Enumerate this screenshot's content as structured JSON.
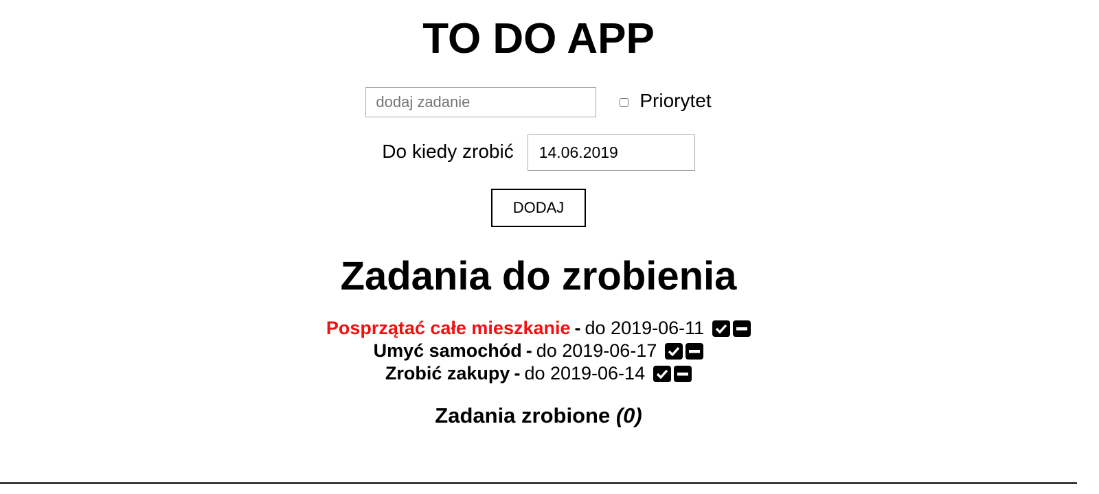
{
  "app": {
    "title": "TO DO APP"
  },
  "form": {
    "task_placeholder": "dodaj zadanie",
    "task_value": "",
    "priority_label": "Priorytet",
    "priority_checked": false,
    "date_label": "Do kiedy zrobić",
    "date_value": "14.06.2019",
    "add_button_label": "DODAJ"
  },
  "todo": {
    "heading": "Zadania do zrobienia",
    "tasks": [
      {
        "name": "Posprzątać całe mieszkanie",
        "priority": true,
        "separator": "-",
        "due": "do 2019-06-11"
      },
      {
        "name": "Umyć samochód",
        "priority": false,
        "separator": "-",
        "due": "do 2019-06-17"
      },
      {
        "name": "Zrobić zakupy",
        "priority": false,
        "separator": "-",
        "due": "do 2019-06-14"
      }
    ],
    "icons": {
      "done": "check-square-icon",
      "remove": "minus-square-icon"
    }
  },
  "done": {
    "heading": "Zadania zrobione",
    "count": "(0)"
  },
  "colors": {
    "priority": "#ee1111",
    "text": "#000000",
    "background": "#ffffff"
  }
}
